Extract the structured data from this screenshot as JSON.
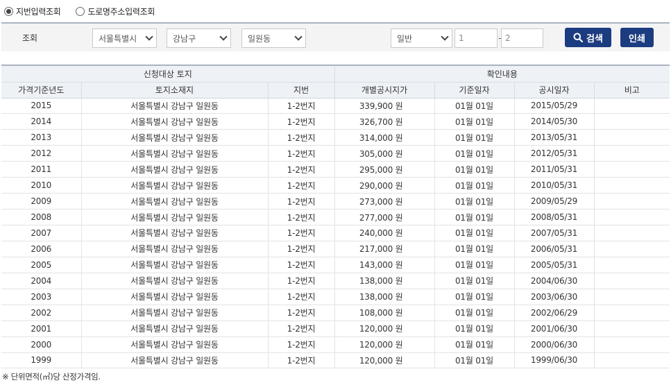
{
  "radio": {
    "jibun_label": "지번입력조회",
    "road_label": "도로명주소입력조회"
  },
  "search": {
    "label": "조회",
    "sido": "서울특별시",
    "sigungu": "강남구",
    "dong": "일원동",
    "land_type": "일반",
    "bon_placeholder": "1",
    "bu_placeholder": "2",
    "dash": "-",
    "search_button": "검색",
    "print_button": "인쇄"
  },
  "table": {
    "group_land": "신청대상 토지",
    "group_confirm": "확인내용",
    "columns": [
      "가격기준년도",
      "토지소재지",
      "지번",
      "개별공시지가",
      "기준일자",
      "공시일자",
      "비고"
    ],
    "rows": [
      [
        "2015",
        "서울특별시 강남구 일원동",
        "1-2번지",
        "339,900 원",
        "01월 01일",
        "2015/05/29",
        ""
      ],
      [
        "2014",
        "서울특별시 강남구 일원동",
        "1-2번지",
        "326,700 원",
        "01월 01일",
        "2014/05/30",
        ""
      ],
      [
        "2013",
        "서울특별시 강남구 일원동",
        "1-2번지",
        "314,000 원",
        "01월 01일",
        "2013/05/31",
        ""
      ],
      [
        "2012",
        "서울특별시 강남구 일원동",
        "1-2번지",
        "305,000 원",
        "01월 01일",
        "2012/05/31",
        ""
      ],
      [
        "2011",
        "서울특별시 강남구 일원동",
        "1-2번지",
        "295,000 원",
        "01월 01일",
        "2011/05/31",
        ""
      ],
      [
        "2010",
        "서울특별시 강남구 일원동",
        "1-2번지",
        "290,000 원",
        "01월 01일",
        "2010/05/31",
        ""
      ],
      [
        "2009",
        "서울특별시 강남구 일원동",
        "1-2번지",
        "273,000 원",
        "01월 01일",
        "2009/05/29",
        ""
      ],
      [
        "2008",
        "서울특별시 강남구 일원동",
        "1-2번지",
        "277,000 원",
        "01월 01일",
        "2008/05/31",
        ""
      ],
      [
        "2007",
        "서울특별시 강남구 일원동",
        "1-2번지",
        "240,000 원",
        "01월 01일",
        "2007/05/31",
        ""
      ],
      [
        "2006",
        "서울특별시 강남구 일원동",
        "1-2번지",
        "217,000 원",
        "01월 01일",
        "2006/05/31",
        ""
      ],
      [
        "2005",
        "서울특별시 강남구 일원동",
        "1-2번지",
        "143,000 원",
        "01월 01일",
        "2005/05/31",
        ""
      ],
      [
        "2004",
        "서울특별시 강남구 일원동",
        "1-2번지",
        "138,000 원",
        "01월 01일",
        "2004/06/30",
        ""
      ],
      [
        "2003",
        "서울특별시 강남구 일원동",
        "1-2번지",
        "138,000 원",
        "01월 01일",
        "2003/06/30",
        ""
      ],
      [
        "2002",
        "서울특별시 강남구 일원동",
        "1-2번지",
        "108,000 원",
        "01월 01일",
        "2002/06/29",
        ""
      ],
      [
        "2001",
        "서울특별시 강남구 일원동",
        "1-2번지",
        "120,000 원",
        "01월 01일",
        "2001/06/30",
        ""
      ],
      [
        "2000",
        "서울특별시 강남구 일원동",
        "1-2번지",
        "120,000 원",
        "01월 01일",
        "2000/06/30",
        ""
      ],
      [
        "1999",
        "서울특별시 강남구 일원동",
        "1-2번지",
        "120,000 원",
        "01월 01일",
        "1999/06/30",
        ""
      ]
    ]
  },
  "footnote": "※ 단위면적(㎡)당 산정가격임.",
  "colors": {
    "button_bg": "#1c3c80",
    "header_bg": "#eef1f5",
    "search_bg": "#f4f4f4",
    "border_accent": "#aab3c0"
  }
}
